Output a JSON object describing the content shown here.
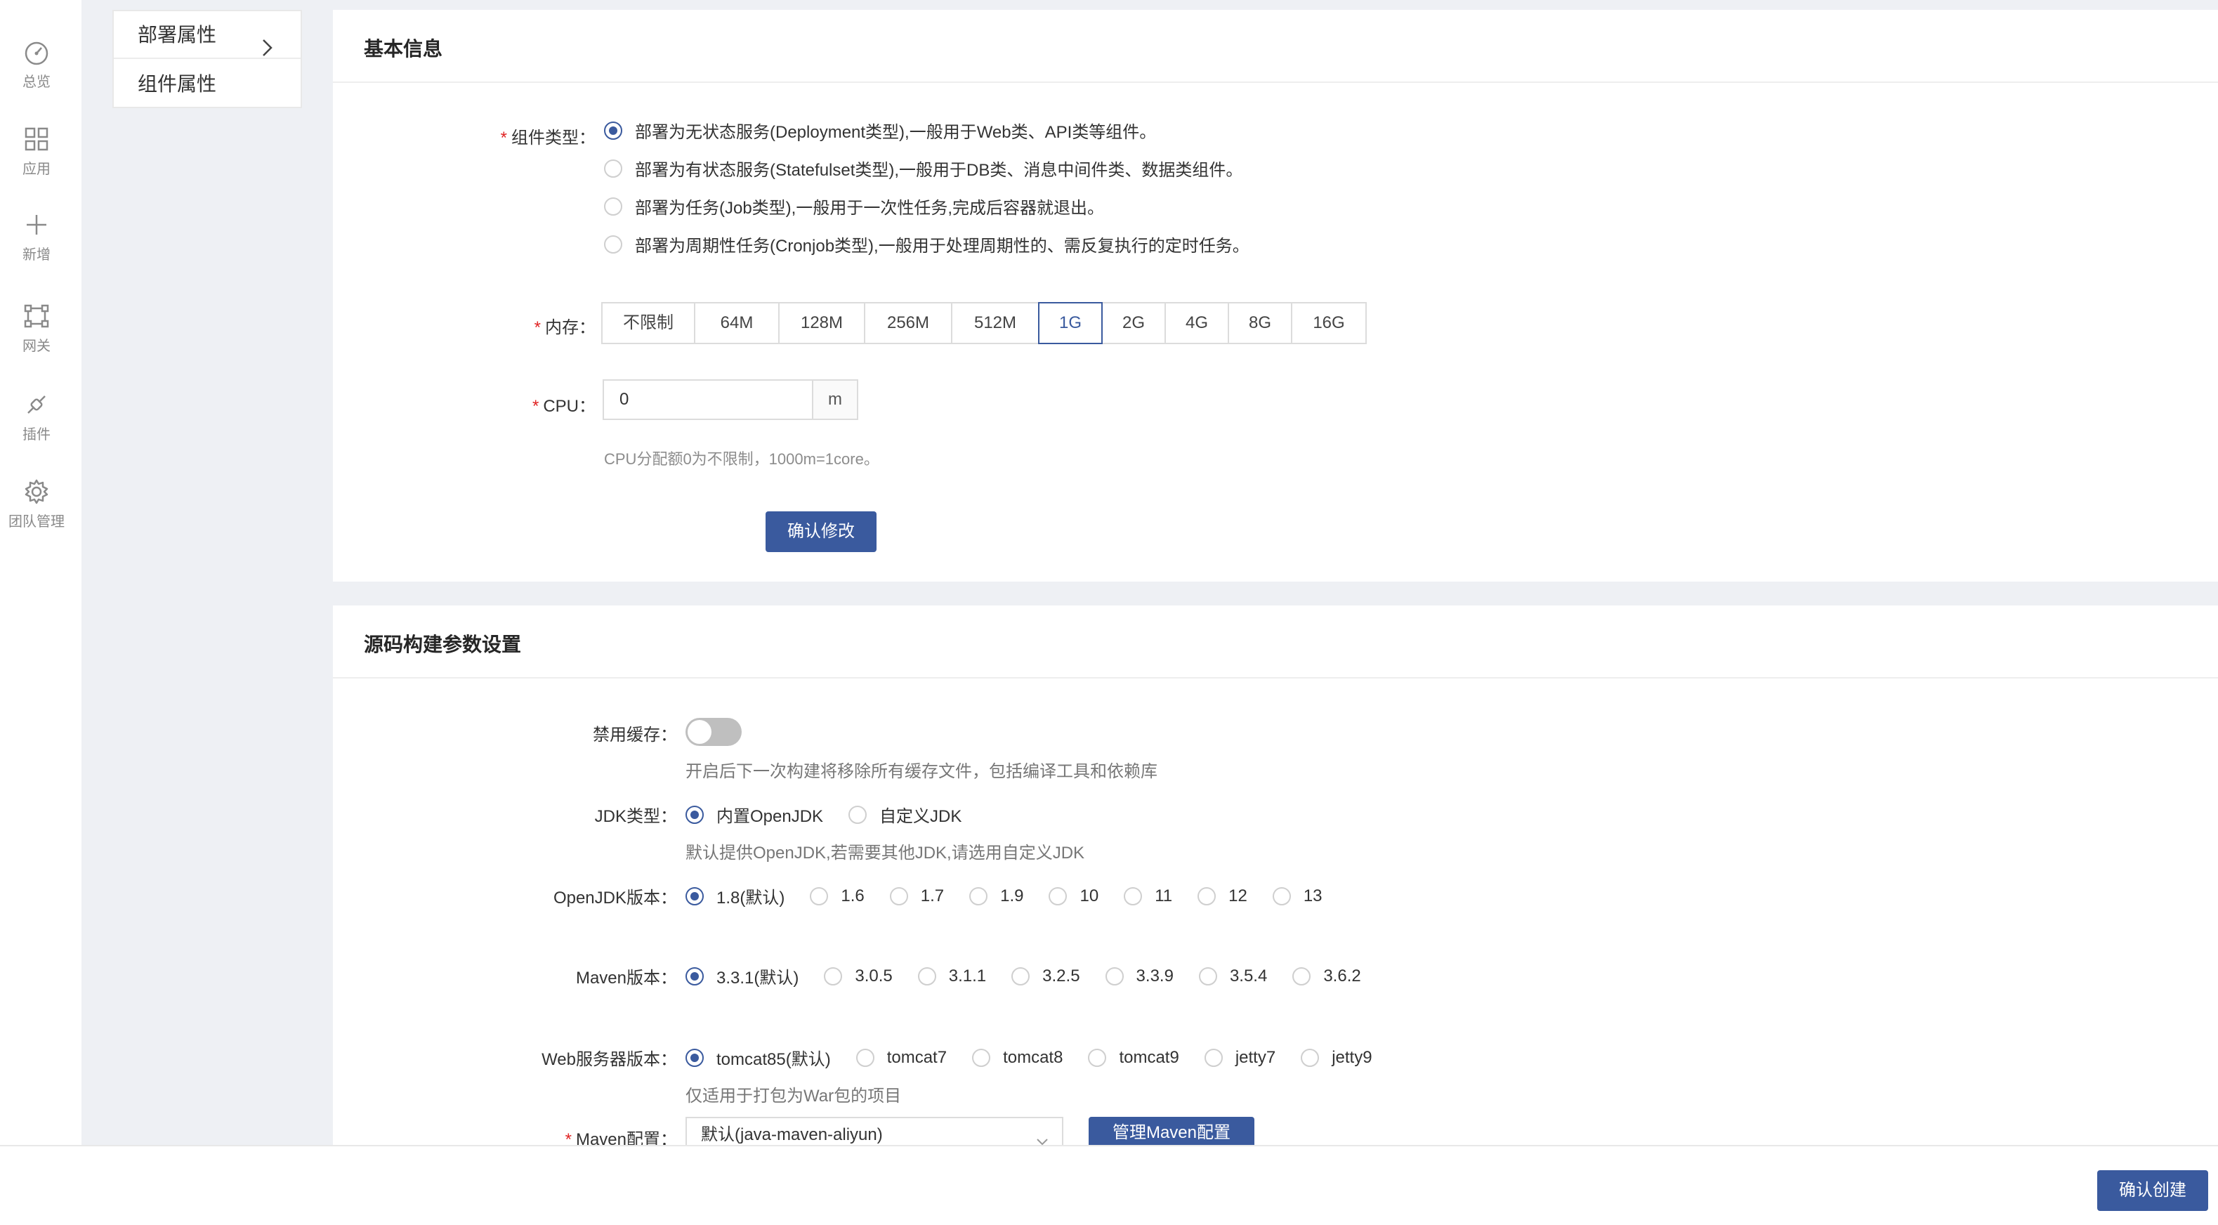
{
  "nav": {
    "items": [
      {
        "label": "总览",
        "icon": "dashboard-icon"
      },
      {
        "label": "应用",
        "icon": "grid-icon"
      },
      {
        "label": "新增",
        "icon": "plus-icon"
      },
      {
        "label": "网关",
        "icon": "gateway-icon"
      },
      {
        "label": "插件",
        "icon": "plugin-icon"
      },
      {
        "label": "团队管理",
        "icon": "gear-icon"
      }
    ]
  },
  "settings_menu": {
    "items": [
      {
        "label": "部署属性",
        "active": true
      },
      {
        "label": "组件属性",
        "active": false
      }
    ]
  },
  "basic_info": {
    "title": "基本信息",
    "component_type": {
      "label": "组件类型",
      "options": [
        "部署为无状态服务(Deployment类型),一般用于Web类、API类等组件。",
        "部署为有状态服务(Statefulset类型),一般用于DB类、消息中间件类、数据类组件。",
        "部署为任务(Job类型),一般用于一次性任务,完成后容器就退出。",
        "部署为周期性任务(Cronjob类型),一般用于处理周期性的、需反复执行的定时任务。"
      ],
      "selected": 0
    },
    "memory": {
      "label": "内存",
      "options": [
        "不限制",
        "64M",
        "128M",
        "256M",
        "512M",
        "1G",
        "2G",
        "4G",
        "8G",
        "16G"
      ],
      "selected": "1G"
    },
    "cpu": {
      "label": "CPU",
      "value": "0",
      "unit": "m",
      "help": "CPU分配额0为不限制，1000m=1core。"
    },
    "confirm_label": "确认修改"
  },
  "build_settings": {
    "title": "源码构建参数设置",
    "disable_cache": {
      "label": "禁用缓存",
      "enabled": false,
      "help": "开启后下一次构建将移除所有缓存文件，包括编译工具和依赖库"
    },
    "jdk_type": {
      "label": "JDK类型",
      "options": [
        "内置OpenJDK",
        "自定义JDK"
      ],
      "selected": "内置OpenJDK",
      "help": "默认提供OpenJDK,若需要其他JDK,请选用自定义JDK"
    },
    "openjdk_version": {
      "label": "OpenJDK版本",
      "options": [
        "1.8(默认)",
        "1.6",
        "1.7",
        "1.9",
        "10",
        "11",
        "12",
        "13"
      ],
      "selected": "1.8(默认)"
    },
    "maven_version": {
      "label": "Maven版本",
      "options": [
        "3.3.1(默认)",
        "3.0.5",
        "3.1.1",
        "3.2.5",
        "3.3.9",
        "3.5.4",
        "3.6.2"
      ],
      "selected": "3.3.1(默认)"
    },
    "web_server_version": {
      "label": "Web服务器版本",
      "options": [
        "tomcat85(默认)",
        "tomcat7",
        "tomcat8",
        "tomcat9",
        "jetty7",
        "jetty9"
      ],
      "selected": "tomcat85(默认)",
      "help": "仅适用于打包为War包的项目"
    },
    "maven_config": {
      "label": "Maven配置",
      "value": "默认(java-maven-aliyun)",
      "manage_label": "管理Maven配置"
    }
  },
  "footer": {
    "confirm_create_label": "确认创建"
  },
  "colors": {
    "primary": "#3a5a9e",
    "required": "#e02424",
    "page_bg": "#eef0f4"
  }
}
